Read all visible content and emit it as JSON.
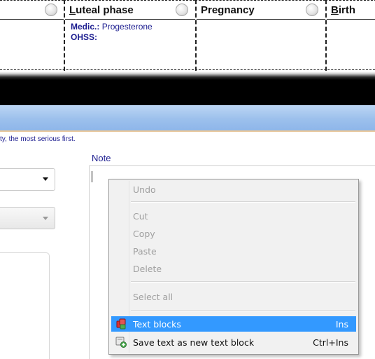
{
  "phase_table": {
    "col0_label": "",
    "luteal": {
      "title_underlined": "L",
      "title_rest": "uteal phase",
      "medic_label": "Medic.:",
      "medic_value": "Progesterone",
      "ohss_label": "OHSS:"
    },
    "pregnancy": {
      "title": "Pregnancy"
    },
    "birth": {
      "title_underlined": "B",
      "title_rest": "irth"
    }
  },
  "hint_text": "ty, the most serious first.",
  "note_label": "Note",
  "context_menu": {
    "items": [
      {
        "label": "Undo",
        "enabled": false
      },
      {
        "label": "Cut",
        "enabled": false
      },
      {
        "label": "Copy",
        "enabled": false
      },
      {
        "label": "Paste",
        "enabled": false
      },
      {
        "label": "Delete",
        "enabled": false
      },
      {
        "label": "Select all",
        "enabled": false
      },
      {
        "label": "Text blocks",
        "shortcut": "Ins",
        "icon": "text-blocks-icon",
        "highlighted": true
      },
      {
        "label": "Save text as new text block",
        "shortcut": "Ctrl+Ins",
        "icon": "save-text-block-icon"
      }
    ]
  },
  "colors": {
    "text_blue": "#1b1c8f",
    "highlight": "#3399ff",
    "band_blue": "#9cc0ec"
  }
}
